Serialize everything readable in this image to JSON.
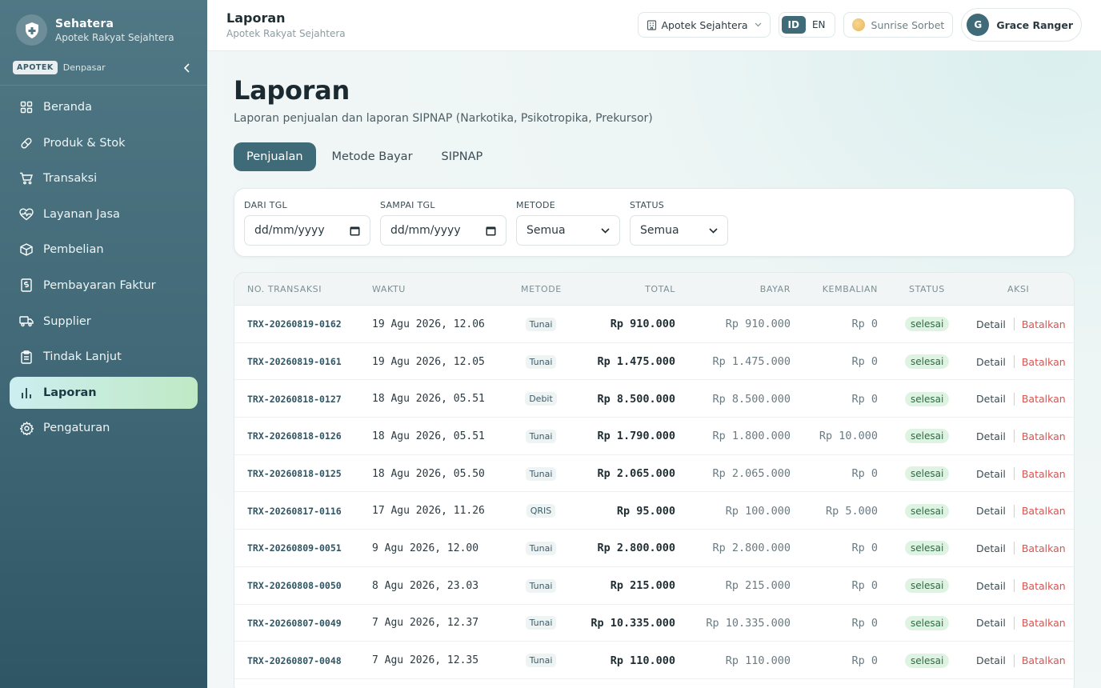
{
  "brand": {
    "name": "Sehatera",
    "subtitle": "Apotek Rakyat Sejahtera"
  },
  "branch": {
    "badge": "APOTEK",
    "city": "Denpasar"
  },
  "sidebar": {
    "items": [
      {
        "label": "Beranda",
        "icon": "grid-icon"
      },
      {
        "label": "Produk & Stok",
        "icon": "pill-icon"
      },
      {
        "label": "Transaksi",
        "icon": "cart-icon"
      },
      {
        "label": "Layanan Jasa",
        "icon": "heart-pulse-icon"
      },
      {
        "label": "Pembelian",
        "icon": "package-icon"
      },
      {
        "label": "Pembayaran Faktur",
        "icon": "invoice-icon"
      },
      {
        "label": "Supplier",
        "icon": "truck-icon"
      },
      {
        "label": "Tindak Lanjut",
        "icon": "clipboard-icon"
      },
      {
        "label": "Laporan",
        "icon": "bar-chart-icon",
        "active": true
      },
      {
        "label": "Pengaturan",
        "icon": "gear-icon"
      }
    ]
  },
  "header": {
    "title": "Laporan",
    "subtitle": "Apotek Rakyat Sejahtera",
    "store_select": "Apotek Sejahtera",
    "lang": {
      "id": "ID",
      "en": "EN",
      "active": "ID"
    },
    "theme": "Sunrise Sorbet",
    "user": {
      "initial": "G",
      "name": "Grace Ranger"
    }
  },
  "page": {
    "title": "Laporan",
    "description": "Laporan penjualan dan laporan SIPNAP (Narkotika, Psikotropika, Prekursor)",
    "tabs": [
      "Penjualan",
      "Metode Bayar",
      "SIPNAP"
    ],
    "active_tab": 0
  },
  "filters": {
    "from": {
      "label": "DARI TGL",
      "placeholder": "dd/mm/yyyy"
    },
    "to": {
      "label": "SAMPAI TGL",
      "placeholder": "dd/mm/yyyy"
    },
    "method": {
      "label": "METODE",
      "value": "Semua"
    },
    "status": {
      "label": "STATUS",
      "value": "Semua"
    }
  },
  "table": {
    "columns": [
      "NO. TRANSAKSI",
      "WAKTU",
      "METODE",
      "TOTAL",
      "BAYAR",
      "KEMBALIAN",
      "STATUS",
      "AKSI"
    ],
    "actions": {
      "detail": "Detail",
      "cancel": "Batalkan"
    },
    "rows": [
      {
        "no": "TRX-20260819-0162",
        "time": "19 Agu 2026, 12.06",
        "method": "Tunai",
        "total": "Rp 910.000",
        "paid": "Rp 910.000",
        "change": "Rp 0",
        "status": "selesai"
      },
      {
        "no": "TRX-20260819-0161",
        "time": "19 Agu 2026, 12.05",
        "method": "Tunai",
        "total": "Rp 1.475.000",
        "paid": "Rp 1.475.000",
        "change": "Rp 0",
        "status": "selesai"
      },
      {
        "no": "TRX-20260818-0127",
        "time": "18 Agu 2026, 05.51",
        "method": "Debit",
        "total": "Rp 8.500.000",
        "paid": "Rp 8.500.000",
        "change": "Rp 0",
        "status": "selesai"
      },
      {
        "no": "TRX-20260818-0126",
        "time": "18 Agu 2026, 05.51",
        "method": "Tunai",
        "total": "Rp 1.790.000",
        "paid": "Rp 1.800.000",
        "change": "Rp 10.000",
        "status": "selesai"
      },
      {
        "no": "TRX-20260818-0125",
        "time": "18 Agu 2026, 05.50",
        "method": "Tunai",
        "total": "Rp 2.065.000",
        "paid": "Rp 2.065.000",
        "change": "Rp 0",
        "status": "selesai"
      },
      {
        "no": "TRX-20260817-0116",
        "time": "17 Agu 2026, 11.26",
        "method": "QRIS",
        "total": "Rp 95.000",
        "paid": "Rp 100.000",
        "change": "Rp 5.000",
        "status": "selesai"
      },
      {
        "no": "TRX-20260809-0051",
        "time": "9 Agu 2026, 12.00",
        "method": "Tunai",
        "total": "Rp 2.800.000",
        "paid": "Rp 2.800.000",
        "change": "Rp 0",
        "status": "selesai"
      },
      {
        "no": "TRX-20260808-0050",
        "time": "8 Agu 2026, 23.03",
        "method": "Tunai",
        "total": "Rp 215.000",
        "paid": "Rp 215.000",
        "change": "Rp 0",
        "status": "selesai"
      },
      {
        "no": "TRX-20260807-0049",
        "time": "7 Agu 2026, 12.37",
        "method": "Tunai",
        "total": "Rp 10.335.000",
        "paid": "Rp 10.335.000",
        "change": "Rp 0",
        "status": "selesai"
      },
      {
        "no": "TRX-20260807-0048",
        "time": "7 Agu 2026, 12.35",
        "method": "Tunai",
        "total": "Rp 110.000",
        "paid": "Rp 110.000",
        "change": "Rp 0",
        "status": "selesai"
      }
    ]
  },
  "colors": {
    "primary": "#3f6b79",
    "danger": "#d9534f",
    "success_bg": "#dff3e3"
  }
}
